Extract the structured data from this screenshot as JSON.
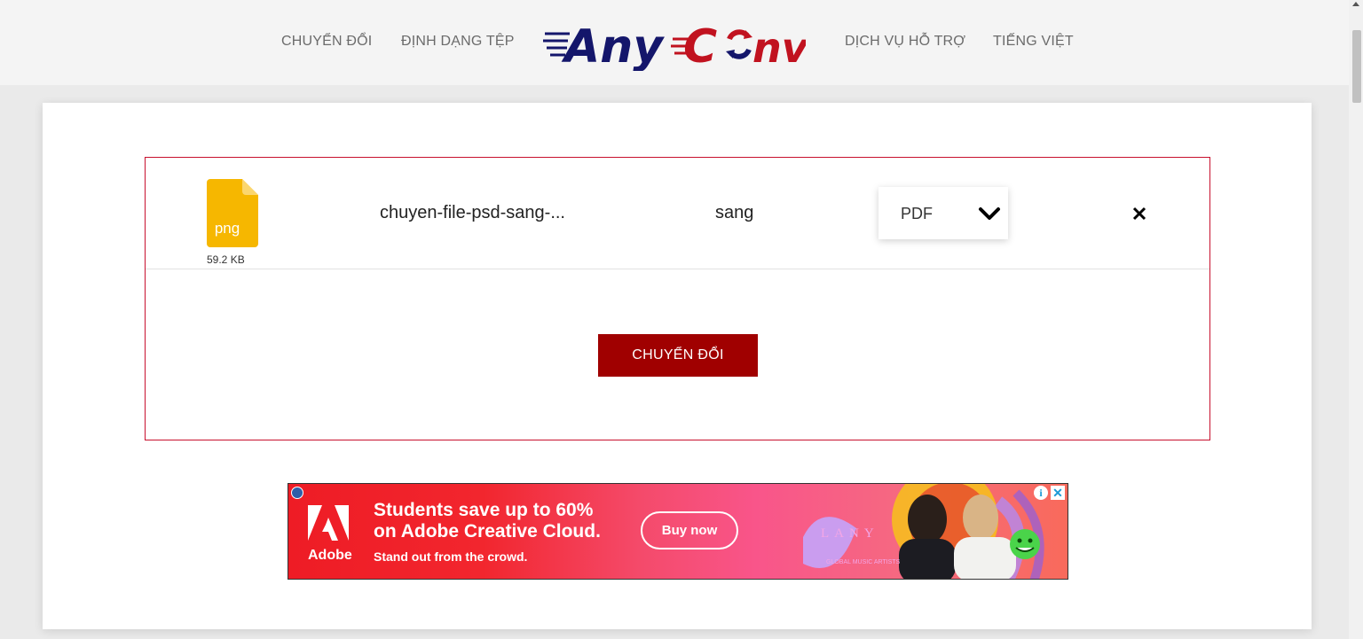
{
  "nav": {
    "convert": "CHUYỂN ĐỔI",
    "formats": "ĐỊNH DẠNG TỆP",
    "support": "DỊCH VỤ HỖ TRỢ",
    "language": "TIẾNG VIỆT"
  },
  "logo": {
    "part1": "Any",
    "part2": "C",
    "part3": "nv",
    "colors": {
      "navy": "#14166b",
      "red": "#c1121f"
    }
  },
  "file": {
    "extension": "png",
    "size": "59.2 KB",
    "name": "chuyen-file-psd-sang-...",
    "to_label": "sang",
    "target_format": "PDF",
    "icon_color": "#f6b700"
  },
  "actions": {
    "convert_button": "CHUYỂN ĐỔI"
  },
  "ad": {
    "brand": "Adobe",
    "headline_line1": "Students save up to 60%",
    "headline_line2": "on Adobe Creative Cloud.",
    "subline": "Stand out from the crowd.",
    "cta": "Buy now",
    "artist": "LANY",
    "artist_sub": "GLOBAL MUSIC ARTISTS",
    "info_glyph": "i",
    "close_glyph": "✕"
  },
  "colors": {
    "accent": "#a00000",
    "border": "#c8102e"
  }
}
